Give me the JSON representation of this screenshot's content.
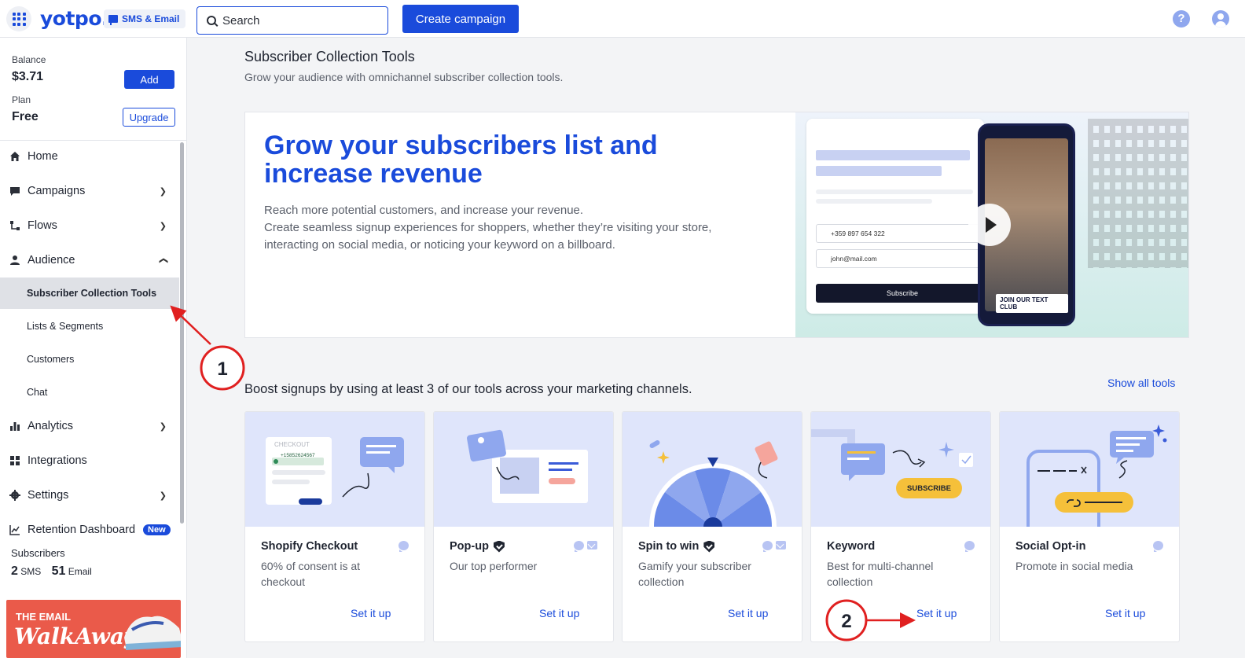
{
  "header": {
    "logo": "yotpo.",
    "product": "SMS & Email",
    "search_placeholder": "Search",
    "create_campaign": "Create campaign"
  },
  "account": {
    "balance_label": "Balance",
    "balance_value": "$3.71",
    "add_label": "Add",
    "plan_label": "Plan",
    "plan_value": "Free",
    "upgrade_label": "Upgrade"
  },
  "nav": {
    "home": "Home",
    "campaigns": "Campaigns",
    "flows": "Flows",
    "audience": "Audience",
    "audience_sub": [
      "Subscriber Collection Tools",
      "Lists & Segments",
      "Customers",
      "Chat"
    ],
    "analytics": "Analytics",
    "integrations": "Integrations",
    "settings": "Settings",
    "retention": "Retention Dashboard",
    "retention_badge": "New"
  },
  "subscribers": {
    "label": "Subscribers",
    "sms_count": "2",
    "sms_label": "SMS",
    "email_count": "51",
    "email_label": "Email"
  },
  "promo": {
    "line1": "THE EMAIL",
    "line2": "WalkAway"
  },
  "page": {
    "title": "Subscriber Collection Tools",
    "subtitle": "Grow your audience with omnichannel subscriber collection tools."
  },
  "hero": {
    "title": "Grow your subscribers list and increase revenue",
    "desc_lines": [
      "Reach more potential customers, and increase your revenue.",
      "Create seamless signup experiences for shoppers, whether they’re visiting your store,",
      "interacting on social media, or noticing your keyword on a billboard."
    ],
    "phone_number": "+359 897 654 322",
    "email": "john@mail.com",
    "subscribe": "Subscribe",
    "text_club": "JOIN OUR TEXT CLUB"
  },
  "tools_section": {
    "heading": "Boost signups by using at least 3 of our tools across your marketing channels.",
    "show_all": "Show all tools"
  },
  "tools": [
    {
      "name": "Shopify Checkout",
      "desc": "60% of consent is at checkout",
      "cta": "Set it up",
      "checkout_label": "CHECKOUT",
      "checkout_phone": "+15852624567"
    },
    {
      "name": "Pop-up",
      "desc": "Our top performer",
      "cta": "Set it up"
    },
    {
      "name": "Spin to win",
      "desc": "Gamify your subscriber collection",
      "cta": "Set it up"
    },
    {
      "name": "Keyword",
      "desc": "Best for multi-channel collection",
      "cta": "Set it up",
      "badge": "SUBSCRIBE"
    },
    {
      "name": "Social Opt-in",
      "desc": "Promote in social media",
      "cta": "Set it up"
    }
  ],
  "annotations": {
    "step1": "1",
    "step2": "2",
    "color": "#e02020"
  }
}
